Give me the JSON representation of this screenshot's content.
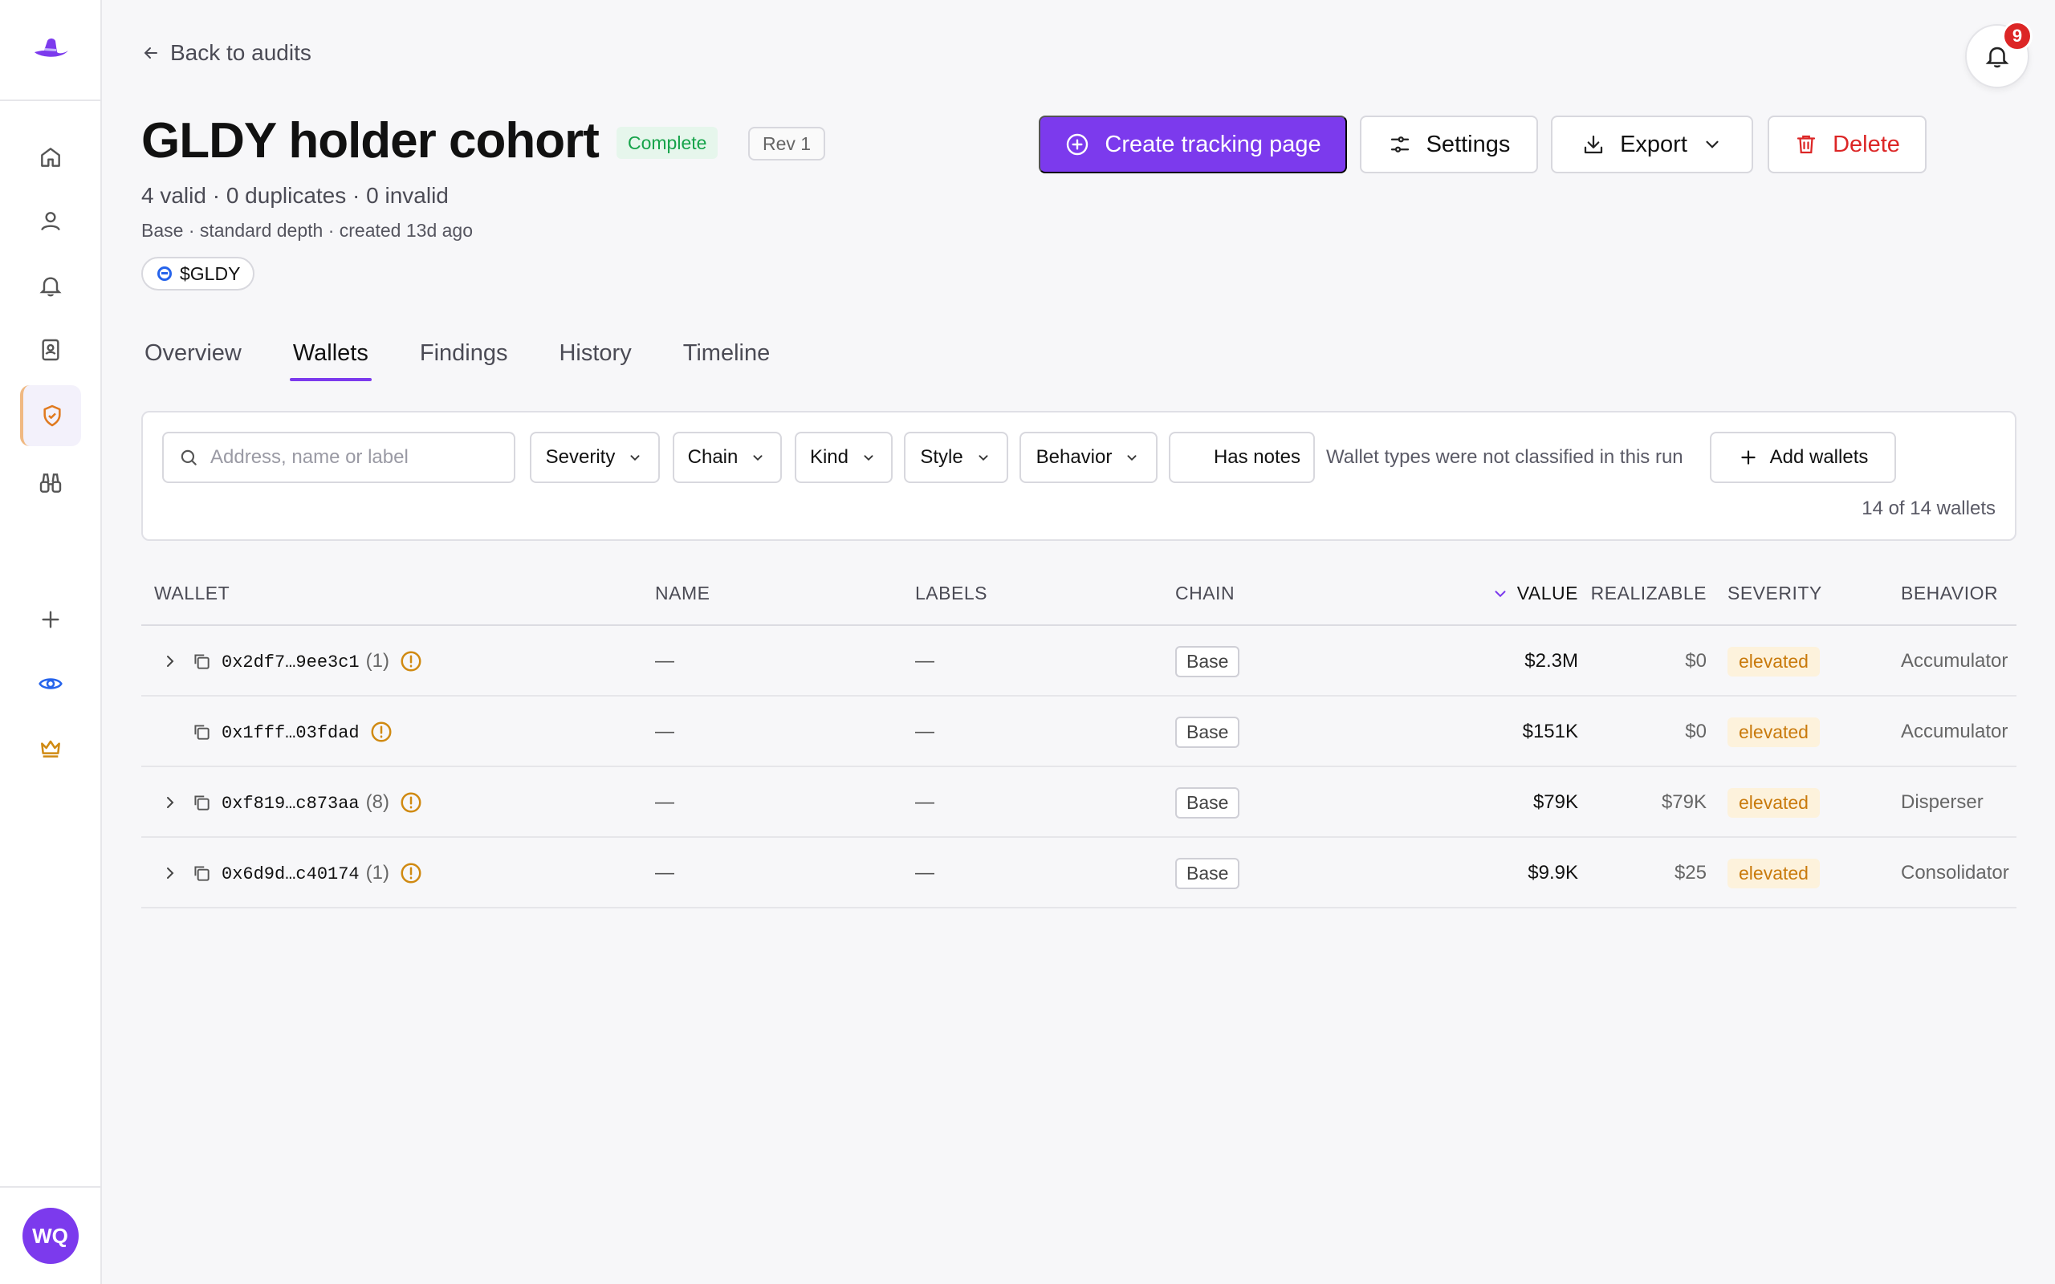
{
  "sidebar": {
    "avatar_initials": "WQ",
    "icons": [
      "logo-hat-icon",
      "home-icon",
      "user-icon",
      "bell-icon",
      "contacts-icon",
      "shield-check-icon",
      "binoculars-icon",
      "plus-icon",
      "eye-icon",
      "crown-icon"
    ]
  },
  "header": {
    "back_label": "Back to audits",
    "notification_count": "9"
  },
  "audit": {
    "title": "GLDY holder cohort",
    "status": "Complete",
    "revision": "Rev 1",
    "summary": "4 valid · 0 duplicates · 0 invalid",
    "meta": "Base · standard depth · created 13d ago",
    "token": "$GLDY"
  },
  "actions": {
    "create_tracking": "Create tracking page",
    "settings": "Settings",
    "export": "Export",
    "delete": "Delete"
  },
  "tabs": [
    {
      "label": "Overview"
    },
    {
      "label": "Wallets"
    },
    {
      "label": "Findings"
    },
    {
      "label": "History"
    },
    {
      "label": "Timeline"
    }
  ],
  "filters": {
    "search_placeholder": "Address, name or label",
    "severity": "Severity",
    "chain": "Chain",
    "kind": "Kind",
    "style": "Style",
    "behavior": "Behavior",
    "has_notes": "Has notes",
    "note": "Wallet types were not classified in this run",
    "add_wallets": "Add wallets",
    "count": "14 of 14 wallets"
  },
  "table": {
    "columns": {
      "wallet": "WALLET",
      "name": "NAME",
      "labels": "LABELS",
      "chain": "CHAIN",
      "value": "VALUE",
      "realizable": "REALIZABLE",
      "severity": "SEVERITY",
      "behavior": "BEHAVIOR"
    },
    "rows": [
      {
        "address": "0x2df7…9ee3c1",
        "count": "(1)",
        "name": "—",
        "labels": "—",
        "chain": "Base",
        "value": "$2.3M",
        "realizable": "$0",
        "severity": "elevated",
        "behavior": "Accumulator"
      },
      {
        "address": "0x1fff…03fdad",
        "count": "",
        "name": "—",
        "labels": "—",
        "chain": "Base",
        "value": "$151K",
        "realizable": "$0",
        "severity": "elevated",
        "behavior": "Accumulator"
      },
      {
        "address": "0xf819…c873aa",
        "count": "(8)",
        "name": "—",
        "labels": "—",
        "chain": "Base",
        "value": "$79K",
        "realizable": "$79K",
        "severity": "elevated",
        "behavior": "Disperser"
      },
      {
        "address": "0x6d9d…c40174",
        "count": "(1)",
        "name": "—",
        "labels": "—",
        "chain": "Base",
        "value": "$9.9K",
        "realizable": "$25",
        "severity": "elevated",
        "behavior": "Consolidator"
      }
    ]
  },
  "colors": {
    "accent": "#7c3aed",
    "danger": "#dc2626",
    "success": "#16a34a",
    "warning": "#c97a0c"
  }
}
